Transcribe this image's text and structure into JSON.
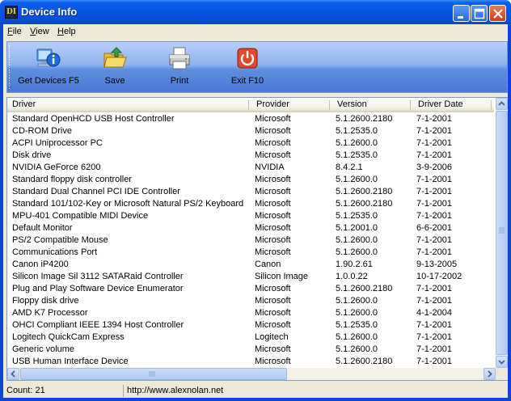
{
  "window": {
    "title": "Device Info",
    "icon_letters": "DI"
  },
  "title_buttons": [
    "minimize",
    "maximize",
    "close"
  ],
  "menu": [
    {
      "label": "File",
      "hotkey": "F",
      "rest": "ile"
    },
    {
      "label": "View",
      "hotkey": "V",
      "rest": "iew"
    },
    {
      "label": "Help",
      "hotkey": "H",
      "rest": "elp"
    }
  ],
  "toolbar": {
    "get_devices": "Get Devices F5",
    "save": "Save",
    "print": "Print",
    "exit": "Exit F10"
  },
  "columns": [
    "Driver",
    "Provider",
    "Version",
    "Driver Date"
  ],
  "rows": [
    [
      "Standard OpenHCD USB Host Controller",
      "Microsoft",
      "5.1.2600.2180",
      "7-1-2001"
    ],
    [
      "CD-ROM Drive",
      "Microsoft",
      "5.1.2535.0",
      "7-1-2001"
    ],
    [
      "ACPI Uniprocessor PC",
      "Microsoft",
      "5.1.2600.0",
      "7-1-2001"
    ],
    [
      "Disk drive",
      "Microsoft",
      "5.1.2535.0",
      "7-1-2001"
    ],
    [
      "NVIDIA GeForce 6200",
      "NVIDIA",
      "8.4.2.1",
      "3-9-2006"
    ],
    [
      "Standard floppy disk controller",
      "Microsoft",
      "5.1.2600.0",
      "7-1-2001"
    ],
    [
      "Standard Dual Channel PCI IDE Controller",
      "Microsoft",
      "5.1.2600.2180",
      "7-1-2001"
    ],
    [
      "Standard 101/102-Key or Microsoft Natural PS/2 Keyboard",
      "Microsoft",
      "5.1.2600.2180",
      "7-1-2001"
    ],
    [
      "MPU-401 Compatible MIDI Device",
      "Microsoft",
      "5.1.2535.0",
      "7-1-2001"
    ],
    [
      "Default Monitor",
      "Microsoft",
      "5.1.2001.0",
      "6-6-2001"
    ],
    [
      "PS/2 Compatible Mouse",
      "Microsoft",
      "5.1.2600.0",
      "7-1-2001"
    ],
    [
      "Communications Port",
      "Microsoft",
      "5.1.2600.0",
      "7-1-2001"
    ],
    [
      "Canon iP4200",
      "Canon",
      "1.90.2.61",
      "9-13-2005"
    ],
    [
      "Silicon Image Sil 3112 SATARaid Controller",
      "Silicon Image",
      "1.0.0.22",
      "10-17-2002"
    ],
    [
      "Plug and Play Software Device Enumerator",
      "Microsoft",
      "5.1.2600.2180",
      "7-1-2001"
    ],
    [
      "Floppy disk drive",
      "Microsoft",
      "5.1.2600.0",
      "7-1-2001"
    ],
    [
      "AMD K7 Processor",
      "Microsoft",
      "5.1.2600.0",
      "4-1-2004"
    ],
    [
      "OHCI Compliant IEEE 1394 Host Controller",
      "Microsoft",
      "5.1.2535.0",
      "7-1-2001"
    ],
    [
      "Logitech QuickCam Express",
      "Logitech",
      "5.1.2600.0",
      "7-1-2001"
    ],
    [
      "Generic volume",
      "Microsoft",
      "5.1.2600.0",
      "7-1-2001"
    ],
    [
      "USB Human Interface Device",
      "Microsoft",
      "5.1.2600.2180",
      "7-1-2001"
    ]
  ],
  "status": {
    "count": "Count: 21",
    "url": "http://www.alexnolan.net"
  },
  "colors": {
    "title_blue": "#0653e2",
    "face": "#ece9d8",
    "exit_red": "#e04a2a"
  }
}
